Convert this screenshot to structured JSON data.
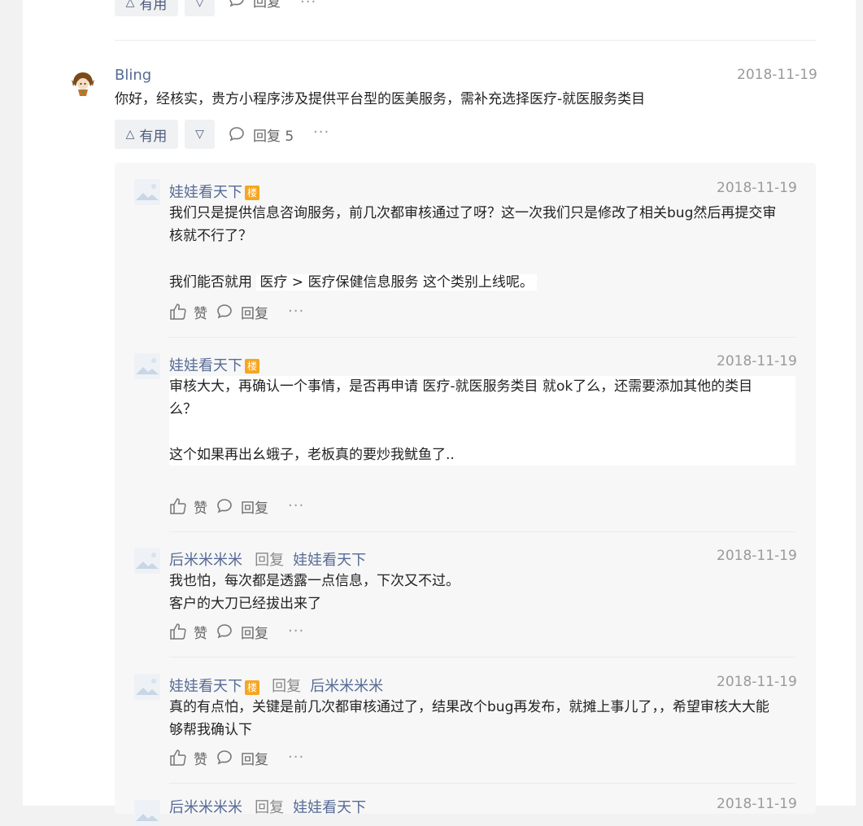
{
  "top_actions": {
    "useful_label": "有用",
    "reply_label": "回复",
    "more": "···"
  },
  "main_comment": {
    "author": "Bling",
    "date": "2018-11-19",
    "content": "你好，经核实，贵方小程序涉及提供平台型的医美服务，需补充选择医疗-就医服务类目",
    "useful_label": "有用",
    "reply_label": "回复 5",
    "more": "···"
  },
  "replies": [
    {
      "author": "娃娃看天下",
      "badge": "楼",
      "date": "2018-11-19",
      "line1": "我们只是提供信息咨询服务，前几次都审核通过了呀？这一次我们只是修改了相关bug然后再提交审",
      "line2": "核就不行了？",
      "line3_prefix": "我们能否就用",
      "line3_tag": "医疗 > 医疗保健信息服务",
      "line3_suffix": "这个类别上线呢。",
      "like_label": "赞",
      "reply_label": "回复",
      "more": "···"
    },
    {
      "author": "娃娃看天下",
      "badge": "楼",
      "date": "2018-11-19",
      "line1": "审核大大，再确认一个事情，是否再申请  医疗-就医服务类目 就ok了么，还需要添加其他的类目",
      "line2": "么？",
      "line3": "这个如果再出幺蛾子，老板真的要炒我鱿鱼了..",
      "like_label": "赞",
      "reply_label": "回复",
      "more": "···"
    },
    {
      "author": "后米米米米",
      "reply_word": "回复",
      "reply_to": "娃娃看天下",
      "date": "2018-11-19",
      "line1": "我也怕，每次都是透露一点信息，下次又不过。",
      "line2": "客户的大刀已经拔出来了",
      "like_label": "赞",
      "reply_label": "回复",
      "more": "···"
    },
    {
      "author": "娃娃看天下",
      "badge": "楼",
      "reply_word": "回复",
      "reply_to": "后米米米米",
      "date": "2018-11-19",
      "line1": "真的有点怕，关键是前几次都审核通过了，结果改个bug再发布，就摊上事儿了，，希望审核大大能",
      "line2": "够帮我确认下",
      "like_label": "赞",
      "reply_label": "回复",
      "more": "···"
    },
    {
      "author": "后米米米米",
      "reply_word": "回复",
      "reply_to": "娃娃看天下",
      "date": "2018-11-19"
    }
  ],
  "colors": {
    "link": "#576b95",
    "badge": "#f5a623",
    "panel": "#f7f7f7"
  }
}
